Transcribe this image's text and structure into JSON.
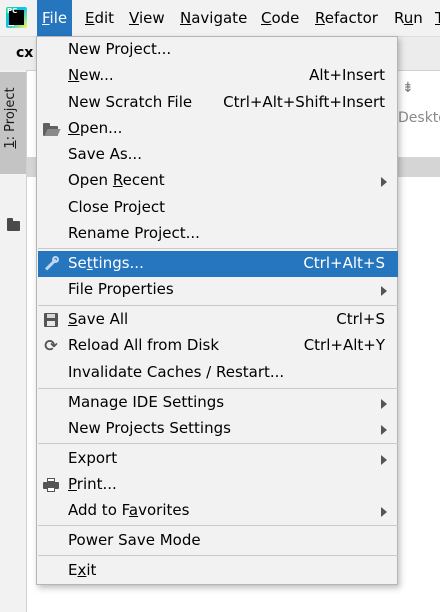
{
  "menubar": {
    "logo_text": "PC",
    "items": [
      {
        "pre": "",
        "mn": "F",
        "post": "ile"
      },
      {
        "pre": "",
        "mn": "E",
        "post": "dit"
      },
      {
        "pre": "",
        "mn": "V",
        "post": "iew"
      },
      {
        "pre": "",
        "mn": "N",
        "post": "avigate"
      },
      {
        "pre": "",
        "mn": "C",
        "post": "ode"
      },
      {
        "pre": "",
        "mn": "R",
        "post": "efactor"
      },
      {
        "pre": "R",
        "mn": "u",
        "post": "n"
      },
      {
        "pre": "",
        "mn": "T",
        "post": ""
      }
    ]
  },
  "editor": {
    "tab_label": "cx",
    "project_tab": {
      "mn": "1",
      "rest": ": Project"
    },
    "path_fragment": "Deskto"
  },
  "menu": {
    "new_project": {
      "pre": "New Pro",
      "mn": "j",
      "post": "ect...",
      "shortcut": ""
    },
    "new": {
      "pre": "",
      "mn": "N",
      "post": "ew...",
      "shortcut": "Alt+Insert"
    },
    "new_scratch": {
      "pre": "New Scratch File",
      "mn": "",
      "post": "",
      "shortcut": "Ctrl+Alt+Shift+Insert"
    },
    "open": {
      "pre": "",
      "mn": "O",
      "post": "pen...",
      "shortcut": ""
    },
    "save_as": {
      "pre": "Save As...",
      "mn": "",
      "post": "",
      "shortcut": ""
    },
    "open_recent": {
      "pre": "Open ",
      "mn": "R",
      "post": "ecent",
      "shortcut": ""
    },
    "close_project": {
      "pre": "Close Project",
      "mn": "",
      "post": "",
      "shortcut": ""
    },
    "rename_project": {
      "pre": "Rename Project...",
      "mn": "",
      "post": "",
      "shortcut": ""
    },
    "settings": {
      "pre": "Se",
      "mn": "t",
      "post": "tings...",
      "shortcut": "Ctrl+Alt+S"
    },
    "file_properties": {
      "pre": "File Properties",
      "mn": "",
      "post": "",
      "shortcut": ""
    },
    "save_all": {
      "pre": "",
      "mn": "S",
      "post": "ave All",
      "shortcut": "Ctrl+S"
    },
    "reload": {
      "pre": "Reload All from Disk",
      "mn": "",
      "post": "",
      "shortcut": "Ctrl+Alt+Y"
    },
    "invalidate": {
      "pre": "Invalidate Caches / Restart...",
      "mn": "",
      "post": "",
      "shortcut": ""
    },
    "manage_ide": {
      "pre": "Manage IDE Settings",
      "mn": "",
      "post": "",
      "shortcut": ""
    },
    "new_projects_settings": {
      "pre": "New Projects Settings",
      "mn": "",
      "post": "",
      "shortcut": ""
    },
    "export": {
      "pre": "Export",
      "mn": "",
      "post": "",
      "shortcut": ""
    },
    "print": {
      "pre": "",
      "mn": "P",
      "post": "rint...",
      "shortcut": ""
    },
    "add_favorites": {
      "pre": "Add to F",
      "mn": "a",
      "post": "vorites",
      "shortcut": ""
    },
    "power_save": {
      "pre": "Power Save Mode",
      "mn": "",
      "post": "",
      "shortcut": ""
    },
    "exit": {
      "pre": "E",
      "mn": "x",
      "post": "it",
      "shortcut": ""
    }
  },
  "colors": {
    "highlight": "#2675bf",
    "menu_bg": "#f2f2f2",
    "separator": "#c9c9c9"
  }
}
